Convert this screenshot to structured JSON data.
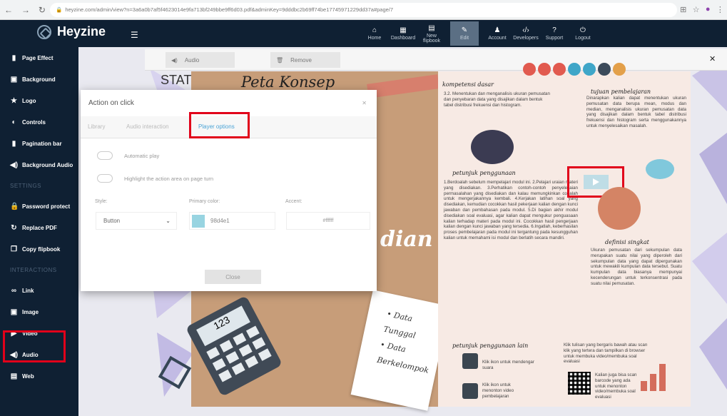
{
  "browser": {
    "url": "heyzine.com/admin/view?n=3a6a0b7af5f4623014e9fa713bf249bbe9ff6d03.pdf&adminKey=9dddbc2b69ff74be17745971229dd37a#page/7"
  },
  "app": {
    "brand": "Heyzine"
  },
  "topmenu": [
    {
      "icon": "home-icon",
      "label": "Home"
    },
    {
      "icon": "dashboard-icon",
      "label": "Dashboard"
    },
    {
      "icon": "file-icon",
      "label": "New flipbook"
    },
    {
      "icon": "edit-icon",
      "label": "Edit"
    },
    {
      "icon": "user-icon",
      "label": "Account"
    },
    {
      "icon": "code-icon",
      "label": "Developers"
    },
    {
      "icon": "help-icon",
      "label": "Support"
    },
    {
      "icon": "power-icon",
      "label": "Logout"
    }
  ],
  "sidebar": {
    "items_top": [
      {
        "label": "Page Effect",
        "icon": "book-icon"
      },
      {
        "label": "Background",
        "icon": "image-icon"
      },
      {
        "label": "Logo",
        "icon": "star-icon"
      },
      {
        "label": "Controls",
        "icon": "toggle-icon"
      },
      {
        "label": "Pagination bar",
        "icon": "bookmark-icon"
      },
      {
        "label": "Background Audio",
        "icon": "speaker-icon"
      }
    ],
    "settings_label": "SETTINGS",
    "items_settings": [
      {
        "label": "Password protect",
        "icon": "lock-icon"
      },
      {
        "label": "Replace PDF",
        "icon": "refresh-icon"
      },
      {
        "label": "Copy flipbook",
        "icon": "copy-icon"
      }
    ],
    "interactions_label": "INTERACTIONS",
    "items_interactions": [
      {
        "label": "Link",
        "icon": "link-icon"
      },
      {
        "label": "Image",
        "icon": "image-icon"
      },
      {
        "label": "Video",
        "icon": "video-icon"
      },
      {
        "label": "Audio",
        "icon": "speaker-icon"
      },
      {
        "label": "Web",
        "icon": "web-icon"
      }
    ]
  },
  "editbar": {
    "audio_label": "Audio",
    "remove_label": "Remove"
  },
  "modal": {
    "title": "Action on click",
    "tabs": [
      "Library",
      "Audio interaction",
      "Player options"
    ],
    "active_tab": "Player options",
    "options": [
      "Automatic play",
      "Highlight the action area on page turn"
    ],
    "style_label": "Style:",
    "style_value": "Button",
    "primary_label": "Primary color:",
    "primary_value": "#98d4e1",
    "primary_text": "98d4e1",
    "accent_label": "Accent:",
    "accent_value": "#ffffff",
    "close_label": "Close"
  },
  "book": {
    "left_stat": "STAT",
    "left_title": "Peta Konsep",
    "left_word": "dian",
    "calc_display": "123",
    "note_lines": [
      "• Data",
      "Tunggal",
      "• Data",
      "Berkelompok"
    ],
    "right": {
      "h1": "kompetensi dasar",
      "p1": "3.2. Menentukan dan menganalisis ukuran pemusatan dan penyebaran data yang disajikan dalam bentuk tabel distribusi frekuensi dan histogram.",
      "h2": "tujuan pembelajaran",
      "p2": "Dinarapkan kalian dapat menentukan ukuran pemusatan data berupa mean, modus dan median, menganalisis ukuran pemusatan data yang disajikan dalam bentuk tabel distribusi frekuensi dan histogram serta menggunakannya untuk menyelesaikan masalah.",
      "h3": "petunjuk penggunaan",
      "p3": "1.Berdoalah sebelum mempelajari modul ini. 2.Pelajari uraian materi yang disediakan. 3.Perhatikan contoh-contoh penyelesaian permasalahan yang disediakan dan kalau memungkinkan cobalah untuk mengerjakannya kembali. 4.Kerjakan latihan soal yang disediakan, kemudian cocokkan hasil pekerjaan kalian dengan kunci jawaban dan pembahasan pada modul. 5.Di bagian akhir modul disediakan soal evaluasi, agar kalian dapat mengukur penguasaan kalian terhadap materi pada modul ini. Cocokkan hasil pengerjaan kalian dengan kunci jawaban yang tersedia. 6.Ingatlah, keberhasilan proses pembelajaran pada modul ini tergantung pada kesungguhan kalian untuk memahami isi modul dan berlatih secara mandiri.",
      "h4": "definisi singkat",
      "p4": "Ukuran pemusatan dari sekumpulan data merupakan suatu nilai yang diperoleh dari sekumpulan data yang dapat dipergunakan untuk mewakili kumpulan data tersebut. Suatu kumpulan data biasanya mempunyai kecenderungan untuk terkonsentrasi pada suatu nilai pemusatan.",
      "h5": "petunjuk penggunaan lain",
      "i1": "Klik ikon untuk mendengar suara",
      "i2": "Klik ikon untuk menonton video pembelajaran",
      "i3": "Klik tulisan yang bergaris bawah atau scan klik yang tertera dan tampilkan di browser untuk membuka video/membuka soal evaluasi",
      "i4": "Kalian juga bisa scan barcode yang ada untuk menonton video/membuka soal evaluasi"
    }
  },
  "colors": {
    "navy": "#0f2033",
    "highlight": "#e1001a",
    "accent_blue": "#4aa3d6"
  }
}
